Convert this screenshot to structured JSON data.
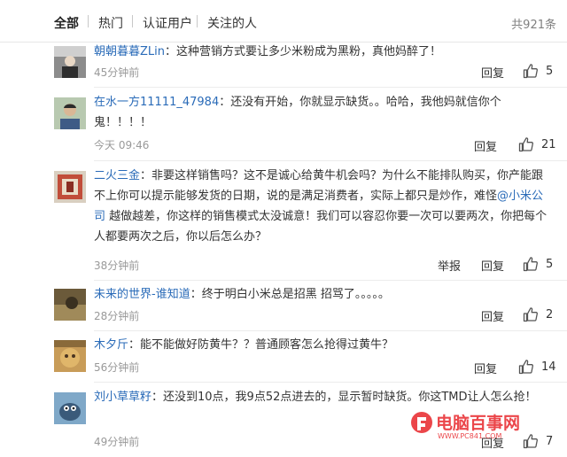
{
  "tabs": {
    "all": "全部",
    "hot": "热门",
    "verified": "认证用户",
    "following": "关注的人",
    "total": "共921条"
  },
  "colors": {
    "link": "#2a6bb8",
    "muted": "#999999"
  },
  "comments": [
    {
      "user": "朝朝暮暮ZLin",
      "text": "：这种营销方式要让多少米粉成为黑粉，真他妈醉了！",
      "time": "45分钟前",
      "reply": "回复",
      "likes": "5"
    },
    {
      "user": "在水一方11111_47984",
      "text": "：还没有开始，你就显示缺货。。哈哈，我他妈就信你个鬼！！！！",
      "time": "今天 09:46",
      "reply": "回复",
      "likes": "21"
    },
    {
      "user": "二火三金",
      "text_before": "：非要这样销售吗？这不是诚心给黄牛机会吗？为什么不能排队购买，你产能跟不上你可以提示能够发货的日期，说的是满足消费者，实际上都只是炒作，难怪",
      "mention": "@小米公司",
      "text_after": " 越做越差，你这样的销售模式太没诚意！我们可以容忍你要一次可以要两次，你把每个人都要两次之后，你以后怎么办？",
      "time": "38分钟前",
      "report": "举报",
      "reply": "回复",
      "likes": "5"
    },
    {
      "user": "未来的世界-谁知道",
      "text": "：终于明白小米总是招黑  招骂了。。。。。",
      "time": "28分钟前",
      "reply": "回复",
      "likes": "2"
    },
    {
      "user": "木夕斤",
      "text": "：能不能做好防黄牛？？普通顾客怎么抢得过黄牛？",
      "time": "56分钟前",
      "reply": "回复",
      "likes": "14"
    },
    {
      "user": "刘小草草籽",
      "text": "：还没到10点，我9点52点进去的，显示暂时缺货。你这TMD让人怎么抢！",
      "time": "49分钟前",
      "reply": "回复",
      "likes": "7"
    }
  ],
  "watermark": {
    "text": "电脑百事网",
    "url": "WWW.PC841.COM"
  }
}
